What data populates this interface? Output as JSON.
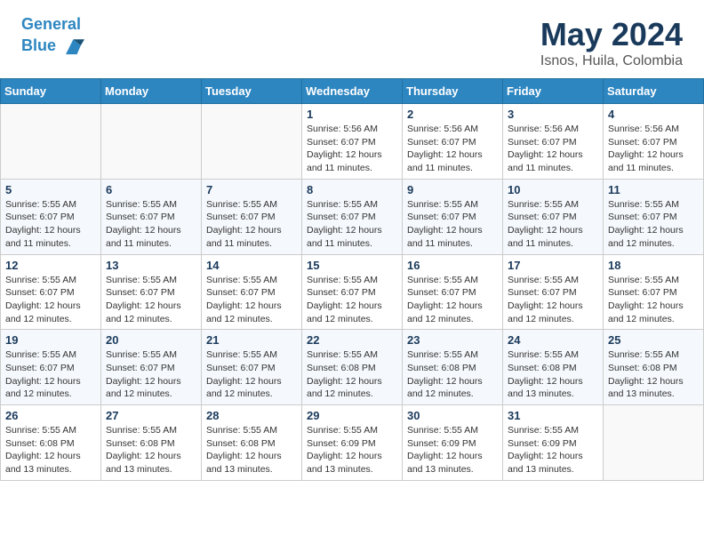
{
  "header": {
    "logo_line1": "General",
    "logo_line2": "Blue",
    "title": "May 2024",
    "subtitle": "Isnos, Huila, Colombia"
  },
  "calendar": {
    "days_of_week": [
      "Sunday",
      "Monday",
      "Tuesday",
      "Wednesday",
      "Thursday",
      "Friday",
      "Saturday"
    ],
    "weeks": [
      [
        {
          "day": "",
          "info": ""
        },
        {
          "day": "",
          "info": ""
        },
        {
          "day": "",
          "info": ""
        },
        {
          "day": "1",
          "info": "Sunrise: 5:56 AM\nSunset: 6:07 PM\nDaylight: 12 hours\nand 11 minutes."
        },
        {
          "day": "2",
          "info": "Sunrise: 5:56 AM\nSunset: 6:07 PM\nDaylight: 12 hours\nand 11 minutes."
        },
        {
          "day": "3",
          "info": "Sunrise: 5:56 AM\nSunset: 6:07 PM\nDaylight: 12 hours\nand 11 minutes."
        },
        {
          "day": "4",
          "info": "Sunrise: 5:56 AM\nSunset: 6:07 PM\nDaylight: 12 hours\nand 11 minutes."
        }
      ],
      [
        {
          "day": "5",
          "info": "Sunrise: 5:55 AM\nSunset: 6:07 PM\nDaylight: 12 hours\nand 11 minutes."
        },
        {
          "day": "6",
          "info": "Sunrise: 5:55 AM\nSunset: 6:07 PM\nDaylight: 12 hours\nand 11 minutes."
        },
        {
          "day": "7",
          "info": "Sunrise: 5:55 AM\nSunset: 6:07 PM\nDaylight: 12 hours\nand 11 minutes."
        },
        {
          "day": "8",
          "info": "Sunrise: 5:55 AM\nSunset: 6:07 PM\nDaylight: 12 hours\nand 11 minutes."
        },
        {
          "day": "9",
          "info": "Sunrise: 5:55 AM\nSunset: 6:07 PM\nDaylight: 12 hours\nand 11 minutes."
        },
        {
          "day": "10",
          "info": "Sunrise: 5:55 AM\nSunset: 6:07 PM\nDaylight: 12 hours\nand 11 minutes."
        },
        {
          "day": "11",
          "info": "Sunrise: 5:55 AM\nSunset: 6:07 PM\nDaylight: 12 hours\nand 12 minutes."
        }
      ],
      [
        {
          "day": "12",
          "info": "Sunrise: 5:55 AM\nSunset: 6:07 PM\nDaylight: 12 hours\nand 12 minutes."
        },
        {
          "day": "13",
          "info": "Sunrise: 5:55 AM\nSunset: 6:07 PM\nDaylight: 12 hours\nand 12 minutes."
        },
        {
          "day": "14",
          "info": "Sunrise: 5:55 AM\nSunset: 6:07 PM\nDaylight: 12 hours\nand 12 minutes."
        },
        {
          "day": "15",
          "info": "Sunrise: 5:55 AM\nSunset: 6:07 PM\nDaylight: 12 hours\nand 12 minutes."
        },
        {
          "day": "16",
          "info": "Sunrise: 5:55 AM\nSunset: 6:07 PM\nDaylight: 12 hours\nand 12 minutes."
        },
        {
          "day": "17",
          "info": "Sunrise: 5:55 AM\nSunset: 6:07 PM\nDaylight: 12 hours\nand 12 minutes."
        },
        {
          "day": "18",
          "info": "Sunrise: 5:55 AM\nSunset: 6:07 PM\nDaylight: 12 hours\nand 12 minutes."
        }
      ],
      [
        {
          "day": "19",
          "info": "Sunrise: 5:55 AM\nSunset: 6:07 PM\nDaylight: 12 hours\nand 12 minutes."
        },
        {
          "day": "20",
          "info": "Sunrise: 5:55 AM\nSunset: 6:07 PM\nDaylight: 12 hours\nand 12 minutes."
        },
        {
          "day": "21",
          "info": "Sunrise: 5:55 AM\nSunset: 6:07 PM\nDaylight: 12 hours\nand 12 minutes."
        },
        {
          "day": "22",
          "info": "Sunrise: 5:55 AM\nSunset: 6:08 PM\nDaylight: 12 hours\nand 12 minutes."
        },
        {
          "day": "23",
          "info": "Sunrise: 5:55 AM\nSunset: 6:08 PM\nDaylight: 12 hours\nand 12 minutes."
        },
        {
          "day": "24",
          "info": "Sunrise: 5:55 AM\nSunset: 6:08 PM\nDaylight: 12 hours\nand 13 minutes."
        },
        {
          "day": "25",
          "info": "Sunrise: 5:55 AM\nSunset: 6:08 PM\nDaylight: 12 hours\nand 13 minutes."
        }
      ],
      [
        {
          "day": "26",
          "info": "Sunrise: 5:55 AM\nSunset: 6:08 PM\nDaylight: 12 hours\nand 13 minutes."
        },
        {
          "day": "27",
          "info": "Sunrise: 5:55 AM\nSunset: 6:08 PM\nDaylight: 12 hours\nand 13 minutes."
        },
        {
          "day": "28",
          "info": "Sunrise: 5:55 AM\nSunset: 6:08 PM\nDaylight: 12 hours\nand 13 minutes."
        },
        {
          "day": "29",
          "info": "Sunrise: 5:55 AM\nSunset: 6:09 PM\nDaylight: 12 hours\nand 13 minutes."
        },
        {
          "day": "30",
          "info": "Sunrise: 5:55 AM\nSunset: 6:09 PM\nDaylight: 12 hours\nand 13 minutes."
        },
        {
          "day": "31",
          "info": "Sunrise: 5:55 AM\nSunset: 6:09 PM\nDaylight: 12 hours\nand 13 minutes."
        },
        {
          "day": "",
          "info": ""
        }
      ]
    ]
  }
}
